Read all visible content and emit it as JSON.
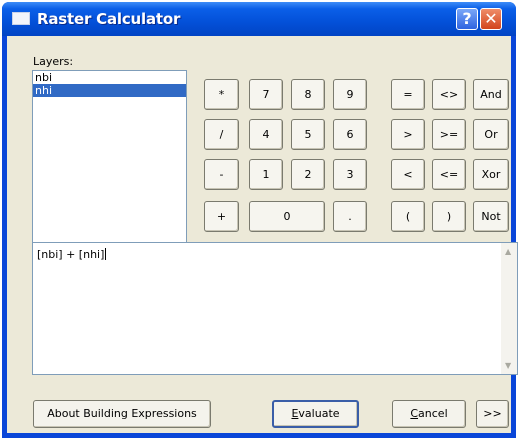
{
  "window": {
    "title": "Raster Calculator"
  },
  "titlebar": {
    "help_label": "?",
    "close_label": "✕"
  },
  "layers": {
    "label": "Layers:",
    "items": [
      {
        "label": "nbi",
        "selected": false
      },
      {
        "label": "nhi",
        "selected": true
      }
    ]
  },
  "keypad": {
    "multiply": "*",
    "seven": "7",
    "eight": "8",
    "nine": "9",
    "equals": "=",
    "not_equal": "<>",
    "and": "And",
    "divide": "/",
    "four": "4",
    "five": "5",
    "six": "6",
    "greater": ">",
    "greater_equal": ">=",
    "or": "Or",
    "minus": "-",
    "one": "1",
    "two": "2",
    "three": "3",
    "less": "<",
    "less_equal": "<=",
    "xor": "Xor",
    "plus": "+",
    "zero": "0",
    "decimal": ".",
    "open_paren": "(",
    "close_paren": ")",
    "not": "Not"
  },
  "expression": {
    "text": "[nbi] + [nhi]"
  },
  "buttons": {
    "about_label": "About Building Expressions",
    "evaluate_rest": "valuate",
    "evaluate_mnemonic": "E",
    "cancel_rest": "ancel",
    "cancel_mnemonic": "C",
    "expand_label": ">>"
  }
}
